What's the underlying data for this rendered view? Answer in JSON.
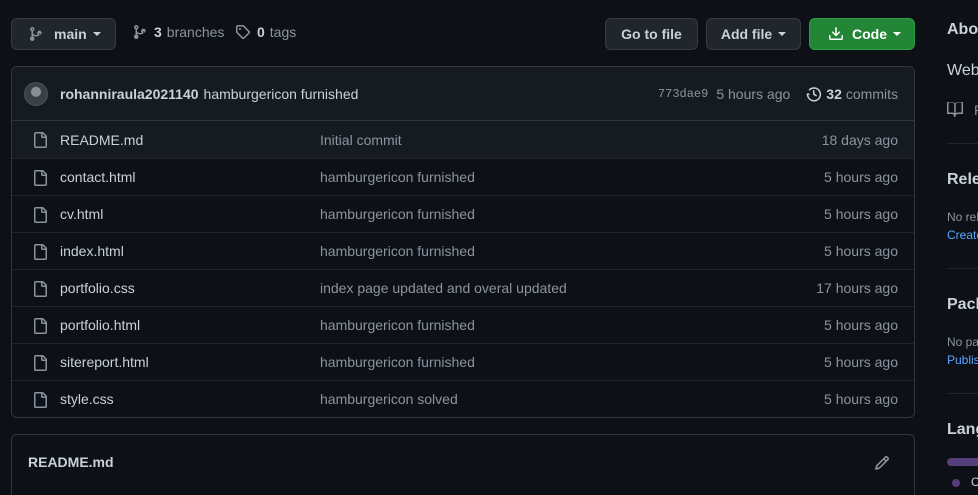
{
  "branch_button": {
    "label": "main"
  },
  "branches": {
    "count": "3",
    "label": "branches"
  },
  "tags": {
    "count": "0",
    "label": "tags"
  },
  "go_to_file": {
    "label": "Go to file"
  },
  "add_file": {
    "label": "Add file"
  },
  "code_button": {
    "label": "Code"
  },
  "latest_commit": {
    "author": "rohanniraula2021140",
    "message": "hamburgericon furnished",
    "sha": "773dae9",
    "time": "5 hours ago",
    "commits_count": "32",
    "commits_label": "commits"
  },
  "files": [
    {
      "name": "README.md",
      "message": "Initial commit",
      "age": "18 days ago"
    },
    {
      "name": "contact.html",
      "message": "hamburgericon furnished",
      "age": "5 hours ago"
    },
    {
      "name": "cv.html",
      "message": "hamburgericon furnished",
      "age": "5 hours ago"
    },
    {
      "name": "index.html",
      "message": "hamburgericon furnished",
      "age": "5 hours ago"
    },
    {
      "name": "portfolio.css",
      "message": "index page updated and overal updated",
      "age": "17 hours ago"
    },
    {
      "name": "portfolio.html",
      "message": "hamburgericon furnished",
      "age": "5 hours ago"
    },
    {
      "name": "sitereport.html",
      "message": "hamburgericon furnished",
      "age": "5 hours ago"
    },
    {
      "name": "style.css",
      "message": "hamburgericon solved",
      "age": "5 hours ago"
    }
  ],
  "readme": {
    "title": "README.md"
  },
  "sidebar": {
    "about": "Abo",
    "about_text": "Web",
    "readme_link": "R",
    "releases": "Rele",
    "releases_text": "No rel",
    "releases_link": "Create",
    "packages": "Pack",
    "packages_text": "No pa",
    "packages_link": "Publis",
    "languages": "Lang",
    "lang_item": "C"
  },
  "colors": {
    "accent_green": "#238636",
    "link_blue": "#58a6ff",
    "language_bar": "#563d7c"
  }
}
